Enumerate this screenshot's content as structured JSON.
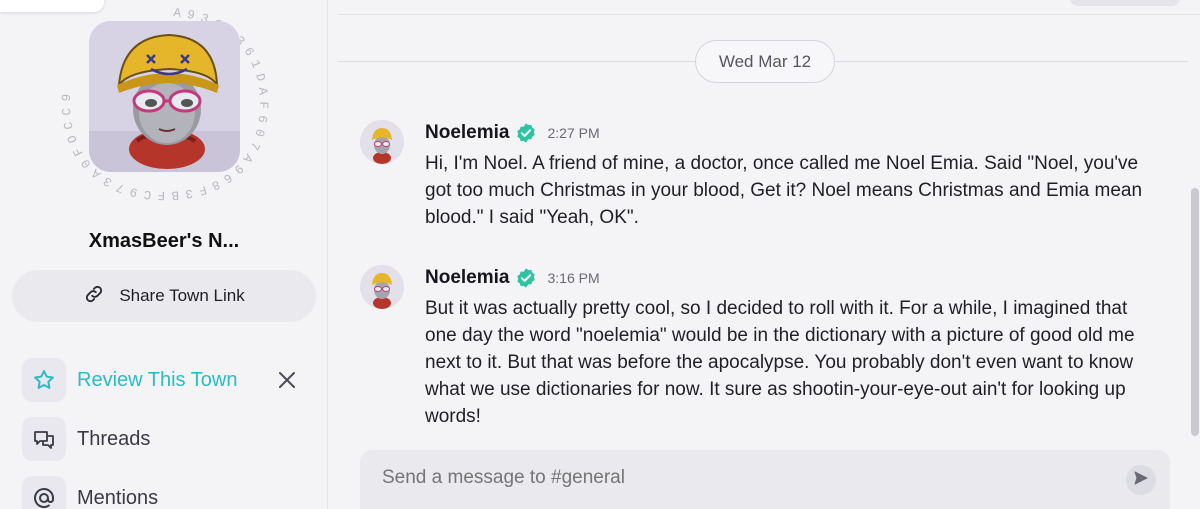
{
  "sidebar": {
    "avatar_ring_text": "A931E361DAF607A968F3BFC973A0FOCC9",
    "town_name": "XmasBeer's N...",
    "share_label": "Share Town Link",
    "nav": [
      {
        "label": "Review This Town",
        "icon": "star-icon"
      },
      {
        "label": "Threads",
        "icon": "threads-icon"
      },
      {
        "label": "Mentions",
        "icon": "at-icon"
      }
    ]
  },
  "main": {
    "date_divider": "Wed Mar 12",
    "messages": [
      {
        "author": "Noelemia",
        "time": "2:27 PM",
        "text": "Hi, I'm Noel. A friend of mine, a doctor, once called me Noel Emia. Said \"Noel, you've got too much Christmas in your blood, Get it? Noel means Christmas and Emia mean blood.\" I said \"Yeah, OK\"."
      },
      {
        "author": "Noelemia",
        "time": "3:16 PM",
        "text": "But it was actually pretty cool, so I decided to roll with it. For a while, I imagined that one day the word \"noelemia\" would be in the dictionary with a picture of good old me next to it. But that was before the apocalypse. You probably don't even want to know what we use dictionaries for now. It sure as shootin-your-eye-out ain't for looking up words!"
      }
    ],
    "composer_placeholder": "Send a message to #general"
  },
  "colors": {
    "accent": "#2bbcc4",
    "verified": "#2ec4a0",
    "background": "#f4f4f6"
  }
}
